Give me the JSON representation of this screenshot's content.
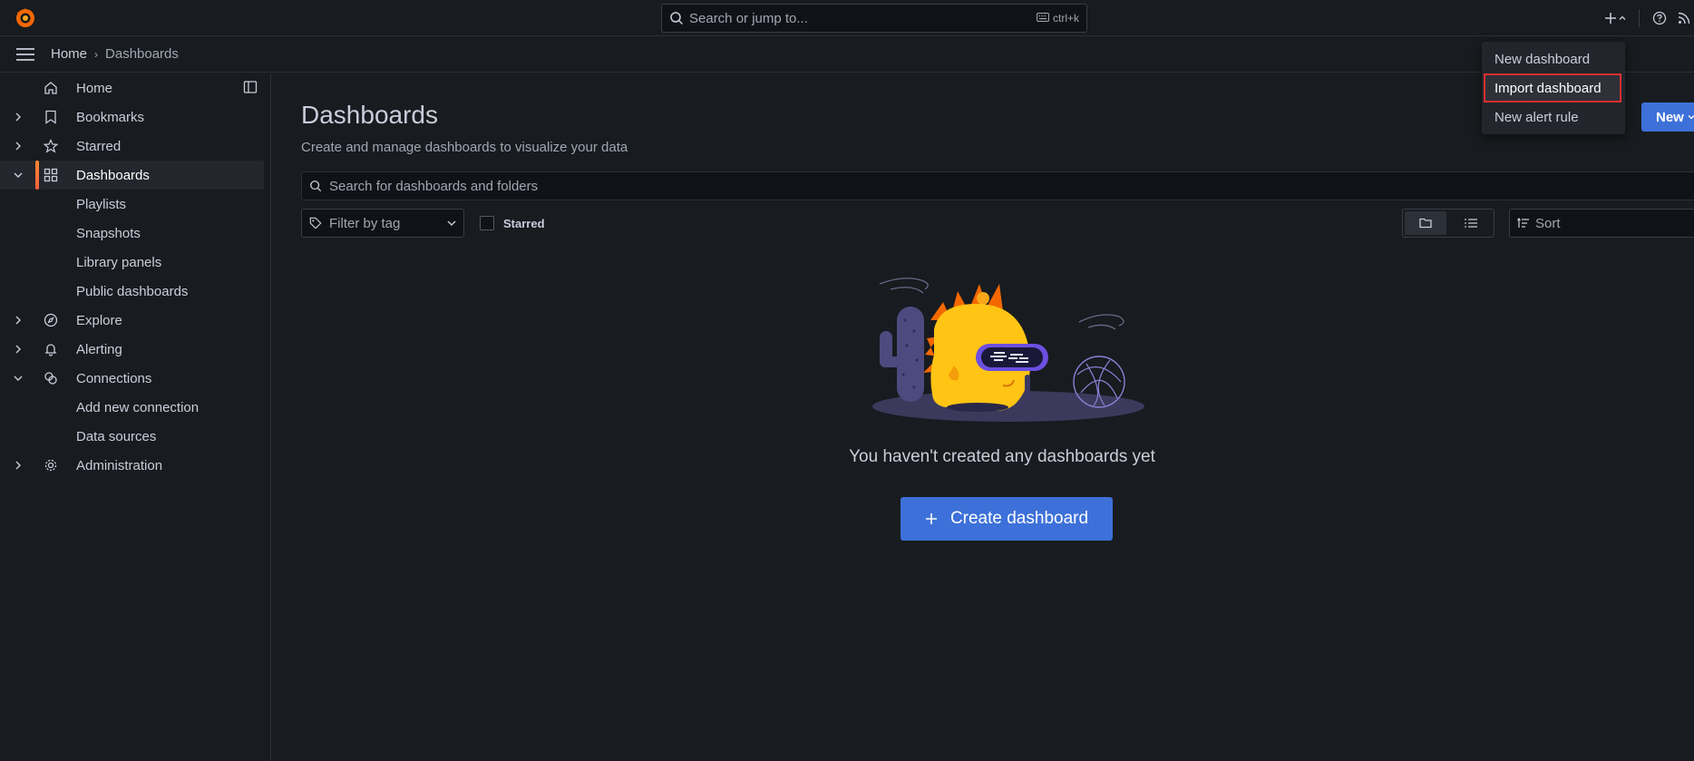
{
  "topbar": {
    "search_placeholder": "Search or jump to...",
    "shortcut": "ctrl+k"
  },
  "breadcrumb": {
    "home": "Home",
    "current": "Dashboards"
  },
  "sidebar": {
    "items": [
      {
        "label": "Home",
        "icon": "home-icon",
        "expandable": false
      },
      {
        "label": "Bookmarks",
        "icon": "bookmark-icon",
        "expandable": true
      },
      {
        "label": "Starred",
        "icon": "star-icon",
        "expandable": true
      },
      {
        "label": "Dashboards",
        "icon": "apps-icon",
        "expandable": true,
        "expanded": true,
        "active": true
      },
      {
        "label": "Playlists",
        "child": true
      },
      {
        "label": "Snapshots",
        "child": true
      },
      {
        "label": "Library panels",
        "child": true
      },
      {
        "label": "Public dashboards",
        "child": true
      },
      {
        "label": "Explore",
        "icon": "compass-icon",
        "expandable": true
      },
      {
        "label": "Alerting",
        "icon": "bell-icon",
        "expandable": true
      },
      {
        "label": "Connections",
        "icon": "link-icon",
        "expandable": true,
        "expanded": true
      },
      {
        "label": "Add new connection",
        "child": true
      },
      {
        "label": "Data sources",
        "child": true
      },
      {
        "label": "Administration",
        "icon": "cog-icon",
        "expandable": true
      }
    ]
  },
  "main": {
    "title": "Dashboards",
    "subtitle": "Create and manage dashboards to visualize your data",
    "new_button": "New",
    "search_placeholder": "Search for dashboards and folders",
    "tag_filter": "Filter by tag",
    "starred_label": "Starred",
    "sort_label": "Sort",
    "empty_text": "You haven't created any dashboards yet",
    "create_button": "Create dashboard"
  },
  "new_menu": {
    "items": [
      "New dashboard",
      "Import dashboard",
      "New alert rule"
    ],
    "highlighted": "Import dashboard"
  },
  "colors": {
    "accent": "#3d71d9",
    "active_bar": "#ff8833",
    "highlight_outline": "#e02f2f"
  }
}
